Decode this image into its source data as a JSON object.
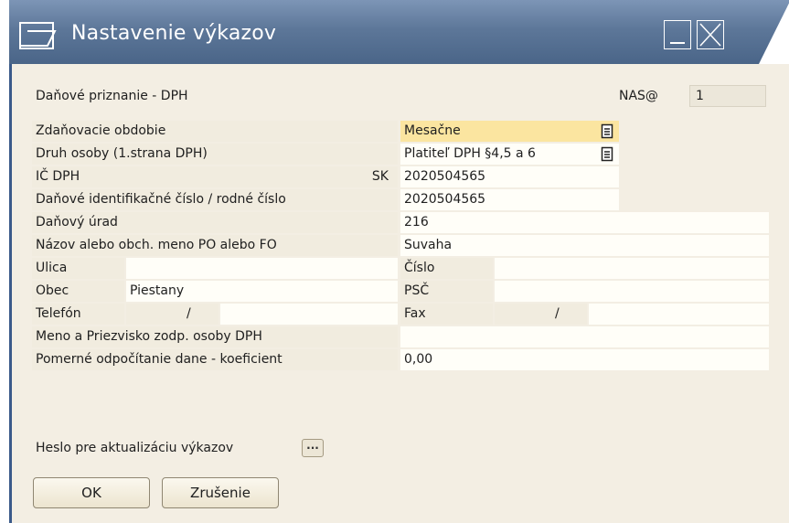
{
  "window": {
    "title": "Nastavenie výkazov"
  },
  "header": {
    "section_label": "Daňové priznanie - DPH",
    "nas_label": "NAS@",
    "nas_value": "1"
  },
  "fields": {
    "zdanovacie_obdobie": {
      "label": "Zdaňovacie obdobie",
      "value": "Mesačne"
    },
    "druh_osoby": {
      "label": "Druh osoby (1.strana DPH)",
      "value": "Platiteľ DPH §4,5 a 6"
    },
    "ic_dph": {
      "label": "IČ DPH",
      "prefix": "SK",
      "value": "2020504565"
    },
    "dic_rc": {
      "label": "Daňové identifikačné číslo / rodné číslo",
      "value": "2020504565"
    },
    "danovy_urad": {
      "label": "Daňový úrad",
      "value": "216"
    },
    "nazov": {
      "label": "Názov alebo obch. meno PO alebo FO",
      "value": "Suvaha"
    },
    "ulica": {
      "label": "Ulica",
      "value": ""
    },
    "cislo": {
      "label": "Číslo",
      "value": ""
    },
    "obec": {
      "label": "Obec",
      "value": "Piestany"
    },
    "psc": {
      "label": "PSČ",
      "value": ""
    },
    "telefon": {
      "label": "Telefón",
      "separator": "/"
    },
    "fax": {
      "label": "Fax",
      "separator": "/"
    },
    "zodp_osoba": {
      "label": "Meno a Priezvisko zodp. osoby DPH",
      "value": ""
    },
    "koeficient": {
      "label": "Pomerné odpočítanie dane - koeficient",
      "value": "0,00"
    }
  },
  "password": {
    "label": "Heslo pre aktualizáciu výkazov",
    "button_label": "..."
  },
  "buttons": {
    "ok": "OK",
    "cancel": "Zrušenie"
  },
  "colors": {
    "title_bar": "#5d7799",
    "form_background": "#f3eee3",
    "highlight_field": "#fbe5a0"
  }
}
